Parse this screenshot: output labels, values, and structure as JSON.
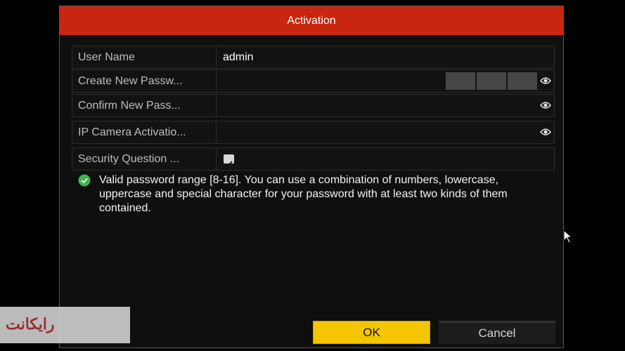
{
  "dialog": {
    "title": "Activation",
    "rows": [
      {
        "label": "User Name",
        "value": "admin"
      },
      {
        "label": "Create New Passw...",
        "value": ""
      },
      {
        "label": "Confirm New Pass...",
        "value": ""
      },
      {
        "label": "IP Camera Activatio...",
        "value": ""
      },
      {
        "label": "Security Question ...",
        "value": ""
      }
    ],
    "info_text": "Valid password range [8-16]. You can use a combination of numbers, lowercase, uppercase and special character for your password with at least two kinds of them contained.",
    "ok_label": "OK",
    "cancel_label": "Cancel",
    "security_question_checked": true
  },
  "watermark": {
    "text": "رایکانت"
  },
  "colors": {
    "title_bar": "#c8260f",
    "ok_button": "#f4c600",
    "info_icon": "#3fb54a"
  },
  "icons": [
    "eye-icon",
    "checkbox-check-icon",
    "check-circle-icon",
    "mouse-cursor-icon"
  ]
}
